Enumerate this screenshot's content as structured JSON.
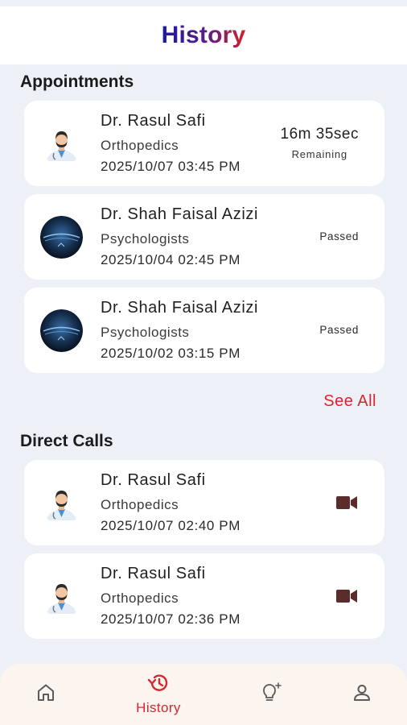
{
  "header": {
    "title": "History"
  },
  "appointments": {
    "section_title": "Appointments",
    "see_all": "See All",
    "items": [
      {
        "name": "Dr. Rasul Safi",
        "specialty": "Orthopedics",
        "datetime": "2025/10/07 03:45 PM",
        "timer": "16m 35sec",
        "status": "Remaining",
        "avatar": "doctor-avatar-icon"
      },
      {
        "name": "Dr. Shah Faisal Azizi",
        "specialty": "Psychologists",
        "datetime": "2025/10/04 02:45 PM",
        "status": "Passed",
        "avatar": "photo-avatar"
      },
      {
        "name": "Dr. Shah Faisal Azizi",
        "specialty": "Psychologists",
        "datetime": "2025/10/02 03:15 PM",
        "status": "Passed",
        "avatar": "photo-avatar"
      }
    ]
  },
  "direct_calls": {
    "section_title": "Direct Calls",
    "items": [
      {
        "name": "Dr. Rasul Safi",
        "specialty": "Orthopedics",
        "datetime": "2025/10/07 02:40 PM",
        "icon": "video-camera-icon"
      },
      {
        "name": "Dr. Rasul Safi",
        "specialty": "Orthopedics",
        "datetime": "2025/10/07 02:36 PM",
        "icon": "video-camera-icon"
      }
    ]
  },
  "bottom_nav": {
    "items": [
      {
        "icon": "home-icon",
        "label": "",
        "active": false
      },
      {
        "icon": "history-icon",
        "label": "History",
        "active": true
      },
      {
        "icon": "lightbulb-icon",
        "label": "",
        "active": false
      },
      {
        "icon": "profile-icon",
        "label": "",
        "active": false
      }
    ]
  },
  "colors": {
    "accent": "#e0232b",
    "background": "#eef0f8",
    "card": "#ffffff",
    "nav_background": "#fcf4ee",
    "icon_brown": "#5a2c2c"
  }
}
